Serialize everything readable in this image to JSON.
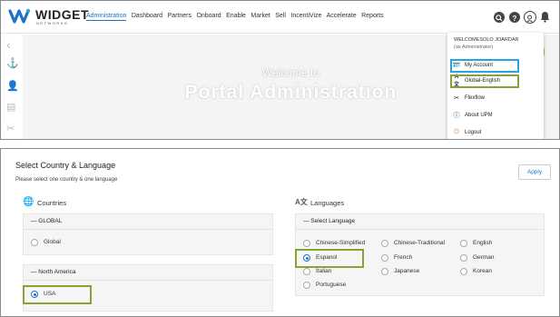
{
  "header": {
    "logo_text": "WIDGET",
    "logo_sub": "NETWORKS",
    "nav": [
      "Administration",
      "Dashboard",
      "Partners",
      "Onboard",
      "Enable",
      "Market",
      "Sell",
      "IncentiVize",
      "Accelerate",
      "Reports"
    ],
    "active_nav": "Administration"
  },
  "hero": {
    "title": "Welcome to",
    "subtitle": "Portal Administration"
  },
  "user_menu": {
    "user_name": "WELCOMESOLO JOARDAR",
    "user_role": "(as Administrator)",
    "items": [
      {
        "label": "My Account",
        "icon": "person-card-icon"
      },
      {
        "label": "Global-English",
        "icon": "translate-icon"
      },
      {
        "label": "Flexflow",
        "icon": "tools-icon"
      },
      {
        "label": "About UPM",
        "icon": "info-icon"
      },
      {
        "label": "Logout",
        "icon": "power-icon"
      }
    ]
  },
  "country_language": {
    "title": "Select Country & Language",
    "subtitle": "Please select one country & one language",
    "apply_label": "Apply",
    "countries_label": "Countries",
    "languages_label": "Languages",
    "global_head": "— GLOBAL",
    "global_option": "Global",
    "na_head": "— North America",
    "na_option": "USA",
    "language_head": "— Select Language",
    "languages": [
      "Chinese-Simplified",
      "Chinese-Traditional",
      "English",
      "Espanol",
      "French",
      "German",
      "Italian",
      "Japanese",
      "Korean",
      "Portuguese"
    ],
    "selected_country": "USA",
    "selected_language": "Espanol"
  },
  "colors": {
    "accent": "#1a73c8",
    "highlight_blue": "#2aa3e0",
    "highlight_green": "#86a336"
  }
}
